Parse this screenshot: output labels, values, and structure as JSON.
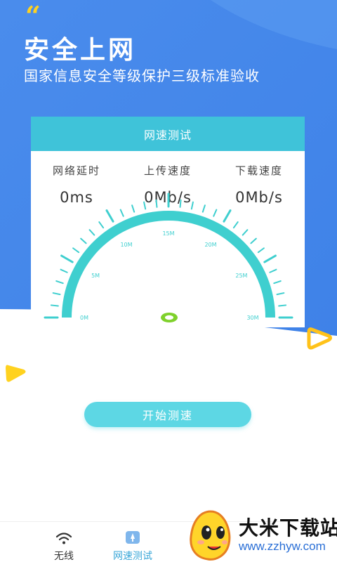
{
  "colors": {
    "hero_blue": "#4d8fec",
    "card_header": "#3fc3d9",
    "gauge_teal": "#3fcfcf",
    "needle": "#7fd12c",
    "button": "#5dd7e4",
    "accent_yellow": "#ffd21f"
  },
  "hero": {
    "quote_mark": "“",
    "title": "安全上网",
    "subtitle": "国家信息安全等级保护三级标准验收"
  },
  "card": {
    "header": "网速测试",
    "stats": [
      {
        "label": "网络延时",
        "value": "0ms"
      },
      {
        "label": "上传速度",
        "value": "0Mb/s"
      },
      {
        "label": "下载速度",
        "value": "0Mb/s"
      }
    ]
  },
  "gauge": {
    "min": 0,
    "max": 30,
    "current": 0,
    "scale_labels": [
      "0M",
      "5M",
      "10M",
      "15M",
      "20M",
      "25M",
      "30M"
    ]
  },
  "start_button": {
    "label": "开始测速"
  },
  "bottom_nav": {
    "items": [
      {
        "label": "无线",
        "icon": "wifi-icon",
        "active": false
      },
      {
        "label": "网速测试",
        "icon": "speed-test-icon",
        "active": true
      },
      {
        "label": "",
        "icon": "more-icon",
        "active": false
      }
    ]
  },
  "watermark": {
    "title": "大米下载站",
    "url": "www.zzhyw.com"
  }
}
